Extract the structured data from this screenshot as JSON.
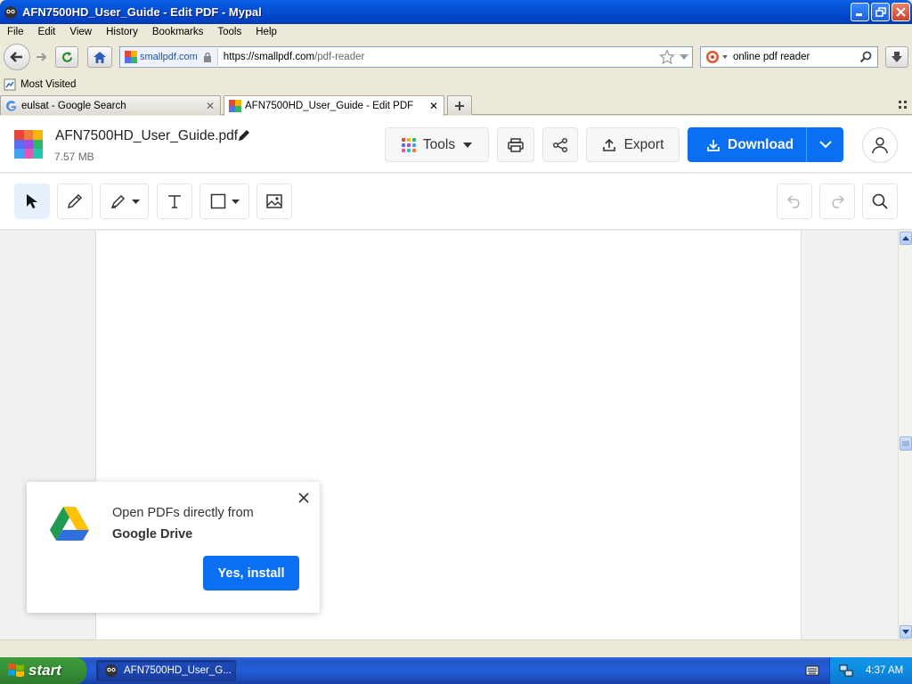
{
  "window": {
    "title": "AFN7500HD_User_Guide - Edit PDF - Mypal"
  },
  "menu": [
    "File",
    "Edit",
    "View",
    "History",
    "Bookmarks",
    "Tools",
    "Help"
  ],
  "navbar": {
    "site_label": "smallpdf.com",
    "url_host": "https://smallpdf.com",
    "url_path": "/pdf-reader",
    "search_query": "online pdf reader"
  },
  "bookmarks": {
    "most_visited": "Most Visited"
  },
  "tabs": [
    {
      "label": "eulsat - Google Search"
    },
    {
      "label": "AFN7500HD_User_Guide - Edit PDF"
    }
  ],
  "app": {
    "file_name": "AFN7500HD_User_Guide.pdf",
    "file_size": "7.57 MB",
    "tools_label": "Tools",
    "export_label": "Export",
    "download_label": "Download"
  },
  "popup": {
    "line1": "Open PDFs directly from",
    "line2": "Google Drive",
    "button": "Yes, install"
  },
  "taskbar": {
    "start": "start",
    "task_item": "AFN7500HD_User_G...",
    "clock": "4:37 AM"
  },
  "colors": {
    "accent": "#0b6ff3",
    "xp_blue": "#245edb",
    "start_green": "#379237"
  }
}
